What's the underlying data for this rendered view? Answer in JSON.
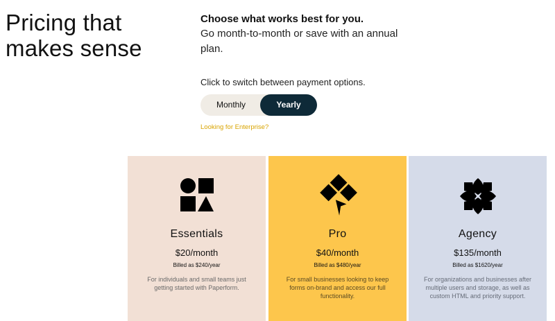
{
  "hero": {
    "title_line1": "Pricing that",
    "title_line2": "makes sense"
  },
  "intro": {
    "headline": "Choose what works best for you.",
    "body": "Go month-to-month or save with an annual plan."
  },
  "billing_toggle": {
    "hint": "Click to switch between payment options.",
    "options": [
      "Monthly",
      "Yearly"
    ],
    "selected": "Yearly"
  },
  "enterprise_link": "Looking for Enterprise?",
  "plans": [
    {
      "name": "Essentials",
      "price": "$20/month",
      "billed": "Billed as $240/year",
      "description": "For individuals and small teams just getting started with Paperform.",
      "icon": "shapes-icon",
      "color": "#f2e0d5"
    },
    {
      "name": "Pro",
      "price": "$40/month",
      "billed": "Billed as $480/year",
      "description": "For small businesses looking to keep forms on-brand and access our full functionality.",
      "icon": "diamond-cursor-icon",
      "color": "#fdc64c"
    },
    {
      "name": "Agency",
      "price": "$135/month",
      "billed": "Billed as $1620/year",
      "description": "For organizations and businesses after multiple users and storage, as well as custom HTML and priority support.",
      "icon": "flower-icon",
      "color": "#d5dbe9"
    }
  ]
}
